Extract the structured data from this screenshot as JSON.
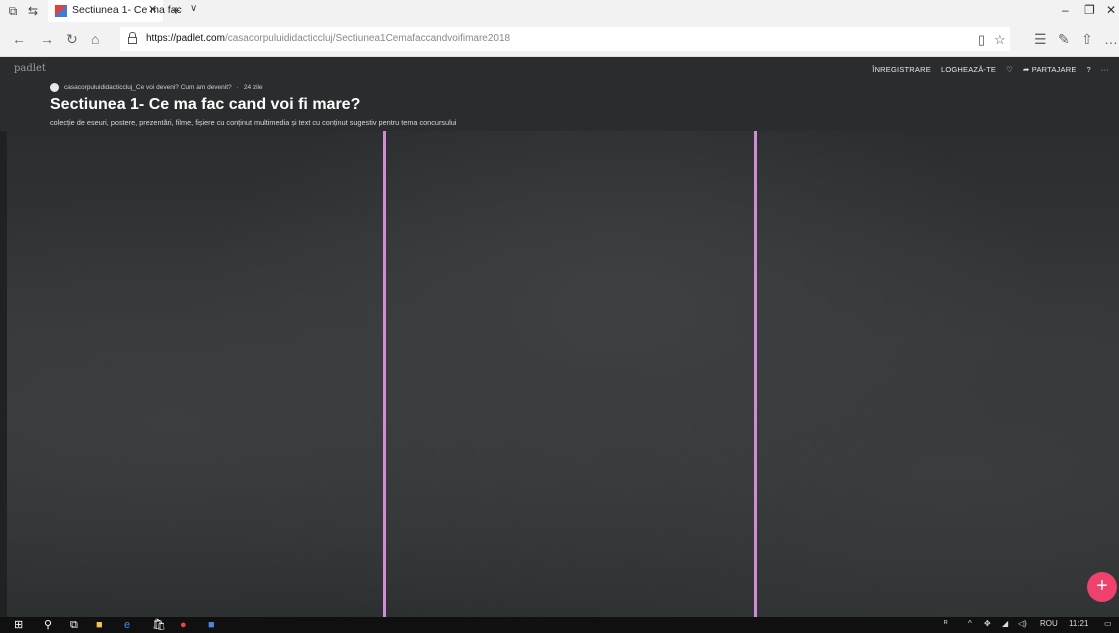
{
  "browser": {
    "tab_title": "Sectiunea 1- Ce ma fac",
    "url_domain": "https://padlet.com",
    "url_path": "/casacorpuluididacticcluj/Sectiunea1Cemafaccandvoifimare2018"
  },
  "padlet": {
    "logo": "padlet",
    "nav": {
      "register": "ÎNREGISTRARE",
      "login": "LOGHEAZĂ-TE",
      "share": "PARTAJARE"
    },
    "author": "casacorpuluididacticcluj_Ce voi deveni? Cum am devenit?",
    "age": "24 zile",
    "title": "Sectiunea 1- Ce ma fac cand voi fi mare?",
    "description": "colecție de eseuri, postere, prezentări, filme, fișiere cu conținut multimedia și text cu conținut sugestiv pentru tema concursului",
    "add_button": "+"
  },
  "taskbar": {
    "language": "ROU",
    "time": "11:21"
  },
  "colors": {
    "divider": "#d58ad6",
    "fab": "#f0416d"
  }
}
